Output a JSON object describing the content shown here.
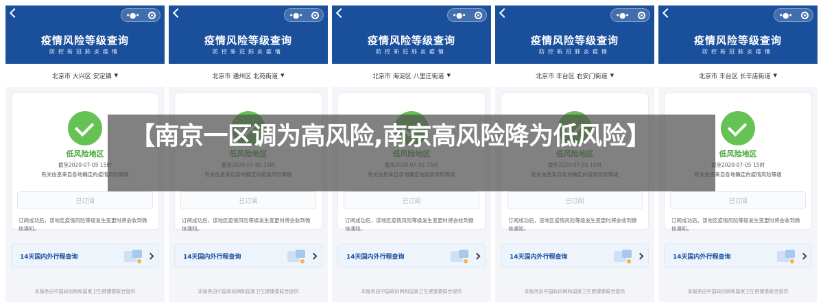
{
  "app": {
    "title": "疫情风险等级查询",
    "subtitle": "防控新冠肺炎疫情"
  },
  "phones": [
    {
      "location": "北京市 大兴区 安定镇"
    },
    {
      "location": "北京市 通州区 北苑街道"
    },
    {
      "location": "北京市 海淀区 八里庄街道"
    },
    {
      "location": "北京市 丰台区 右安门街道"
    },
    {
      "location": "北京市 丰台区 长辛店街道"
    }
  ],
  "card": {
    "risk_level": "低风险地区",
    "deadline": "截至2020-07-05 15时",
    "source_note": "有关信息来自各地确定的疫情风险等级",
    "subscribed_label": "已订阅",
    "sub_note": "订阅成功后，该地区疫情风险等级发生变更时将会收到微信通知。"
  },
  "trip": {
    "label": "14天国内外行程查询"
  },
  "footer": {
    "note": "本服务由中国政府网和国家卫生健康委联合提供"
  },
  "headline": "【南京一区调为高风险,南京高风险降为低风险】",
  "colors": {
    "header_blue": "#1a4f9c",
    "success_green": "#66c254",
    "overlay_gray": "#505050"
  },
  "icons": [
    "back-icon",
    "more-icon",
    "target-icon",
    "caret-down-icon",
    "check-icon",
    "chevron-right-icon"
  ]
}
